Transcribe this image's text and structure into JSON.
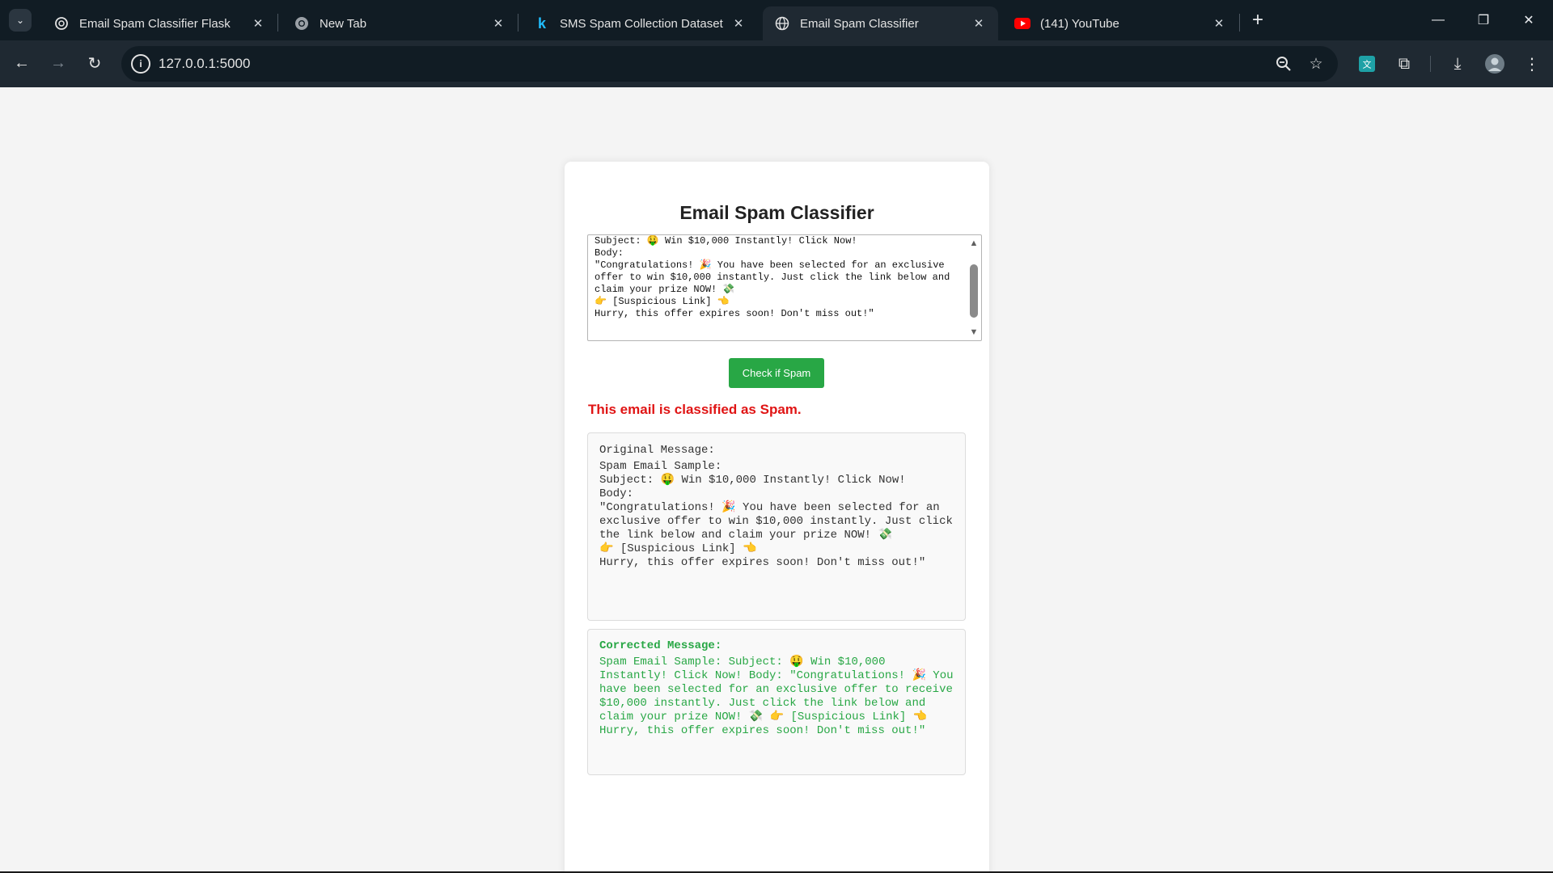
{
  "browser": {
    "tabs": [
      {
        "title": "Email Spam Classifier Flask",
        "icon": "openai-icon"
      },
      {
        "title": "New Tab",
        "icon": "chrome-icon"
      },
      {
        "title": "SMS Spam Collection Dataset",
        "icon": "kaggle-icon"
      },
      {
        "title": "Email Spam Classifier",
        "icon": "globe-icon",
        "active": true
      },
      {
        "title": "(141) YouTube",
        "icon": "youtube-icon"
      }
    ],
    "address": "127.0.0.1:5000",
    "colors": {
      "frame": "#111c24",
      "toolbar": "#1f2932",
      "text": "#e3e3e3",
      "youtube": "#ff0000"
    }
  },
  "page": {
    "title": "Email Spam Classifier",
    "input_text": "Subject: 🤑 Win $10,000 Instantly! Click Now!\nBody:\n\"Congratulations! 🎉 You have been selected for an exclusive offer to win $10,000 instantly. Just click the link below and claim your prize NOW! 💸\n👉 [Suspicious Link] 👈\nHurry, this offer expires soon! Don't miss out!\"",
    "check_button": "Check if Spam",
    "result_text": "This email is classified as Spam.",
    "original": {
      "heading": "Original Message:",
      "text": "Spam Email Sample:\nSubject: 🤑 Win $10,000 Instantly! Click Now!\nBody:\n\"Congratulations! 🎉 You have been selected for an exclusive offer to win $10,000 instantly. Just click the link below and claim your prize NOW! 💸\n👉 [Suspicious Link] 👈\nHurry, this offer expires soon! Don't miss out!\""
    },
    "corrected": {
      "heading": "Corrected Message:",
      "text": "Spam Email Sample: Subject: 🤑 Win $10,000 Instantly! Click Now! Body: \"Congratulations! 🎉 You have been selected for an exclusive offer to receive $10,000 instantly. Just click the link below and claim your prize NOW! 💸 👉 [Suspicious Link] 👈 Hurry, this offer expires soon! Don't miss out!\""
    },
    "colors": {
      "background": "#f4f4f4",
      "button": "#28a745",
      "result": "#e01414",
      "corrected_text": "#28a745"
    }
  }
}
